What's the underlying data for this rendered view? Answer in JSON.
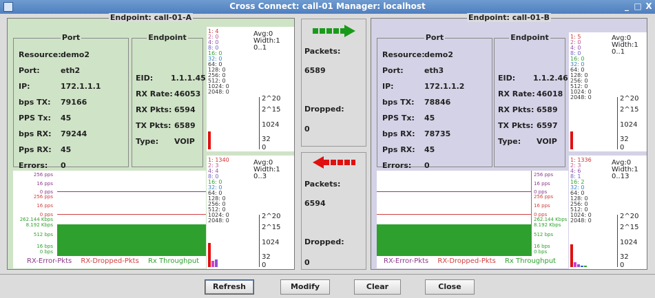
{
  "window": {
    "title": "Cross Connect: call-01  Manager: localhost",
    "controls": [
      "_",
      "□",
      "X"
    ]
  },
  "labels": {
    "port": "Port",
    "endpoint": "Endpoint",
    "resource": "Resource:",
    "port_field": "Port:",
    "ip": "IP:",
    "bps_tx": "bps TX:",
    "pps_tx": "PPS Tx:",
    "bps_rx": "bps RX:",
    "pps_rx": "Pps RX:",
    "errors": "Errors:",
    "eid": "EID:",
    "rx_rate": "RX Rate:",
    "rx_pkts": "RX Pkts:",
    "tx_pkts": "TX Pkts:",
    "type": "Type:",
    "packets": "Packets:",
    "dropped": "Dropped:"
  },
  "endpoint_a": {
    "title": "Endpoint: call-01-A",
    "port": {
      "resource": "demo2",
      "port": "eth2",
      "ip": "172.1.1.1",
      "bps_tx": "79166",
      "pps_tx": "45",
      "bps_rx": "79244",
      "pps_rx": "45",
      "errors": "0"
    },
    "endpoint": {
      "eid": "1.1.1.45",
      "rx_rate": "46053",
      "rx_pkts": "6594",
      "tx_pkts": "6589",
      "type": "VOIP"
    },
    "hist_top": {
      "bins": [
        "1: 4",
        "2: 0",
        "4: 0",
        "8: 0",
        "16: 0",
        "32: 0",
        "64: 0",
        "128: 0",
        "256: 0",
        "512: 0",
        "1024: 0",
        "2048: 0"
      ],
      "avg": "Avg:0",
      "width": "Width:1",
      "range": "0..1",
      "ticks": [
        "2^20",
        "2^15",
        "1024",
        "32",
        "0"
      ],
      "bars": [
        0.6
      ]
    },
    "hist_bottom": {
      "bins": [
        "1: 1340",
        "2: 3",
        "4: 4",
        "8: 0",
        "16: 0",
        "32: 0",
        "64: 0",
        "128: 0",
        "256: 0",
        "512: 0",
        "1024: 0",
        "2048: 0"
      ],
      "avg": "Avg:0",
      "width": "Width:1",
      "range": "0..3",
      "ticks": [
        "2^20",
        "2^15",
        "1024",
        "32",
        "0"
      ],
      "bars": [
        0.8,
        0.2,
        0.25
      ]
    },
    "throughput": {
      "y_labels": [
        "256 pps",
        "16 pps",
        "0 pps",
        "256 pps",
        "16 pps",
        "0 pps",
        "262.144 Kbps",
        "8.192 Kbps",
        "512 bps",
        "16 bps",
        "0 bps"
      ],
      "legend": [
        "RX-Error-Pkts",
        "RX-Dropped-Pkts",
        "Rx Throughput"
      ]
    }
  },
  "endpoint_b": {
    "title": "Endpoint: call-01-B",
    "port": {
      "resource": "demo2",
      "port": "eth3",
      "ip": "172.1.1.2",
      "bps_tx": "78846",
      "pps_tx": "45",
      "bps_rx": "78735",
      "pps_rx": "45",
      "errors": "0"
    },
    "endpoint": {
      "eid": "1.1.2.46",
      "rx_rate": "46018",
      "rx_pkts": "6589",
      "tx_pkts": "6597",
      "type": "VOIP"
    },
    "hist_top": {
      "bins": [
        "1: 5",
        "2: 0",
        "4: 0",
        "8: 0",
        "16: 0",
        "32: 0",
        "64: 0",
        "128: 0",
        "256: 0",
        "512: 0",
        "1024: 0",
        "2048: 0"
      ],
      "avg": "Avg:0",
      "width": "Width:1",
      "range": "0..1",
      "ticks": [
        "2^20",
        "2^15",
        "1024",
        "32",
        "0"
      ],
      "bars": [
        0.6
      ]
    },
    "hist_bottom": {
      "bins": [
        "1: 1336",
        "2: 3",
        "4: 6",
        "8: 1",
        "16: 2",
        "32: 0",
        "64: 0",
        "128: 0",
        "256: 0",
        "512: 0",
        "1024: 0",
        "2048: 0"
      ],
      "avg": "Avg:0",
      "width": "Width:1",
      "range": "0..13",
      "ticks": [
        "2^20",
        "2^15",
        "1024",
        "32",
        "0"
      ],
      "bars": [
        0.75,
        0.15,
        0.1,
        0.05,
        0.05
      ]
    },
    "throughput": {
      "y_labels": [
        "256 pps",
        "16 pps",
        "0 pps",
        "256 pps",
        "16 pps",
        "0 pps",
        "262.144 Kbps",
        "8.192 Kbps",
        "512 bps",
        "16 bps",
        "0 bps"
      ],
      "legend": [
        "RX-Error-Pkts",
        "RX-Dropped-Pkts",
        "Rx Throughput"
      ]
    }
  },
  "center": {
    "a_to_b": {
      "packets": "6589",
      "dropped": "0"
    },
    "b_to_a": {
      "packets": "6594",
      "dropped": "0"
    }
  },
  "buttons": {
    "refresh": "Refresh",
    "modify": "Modify",
    "clear": "Clear",
    "close": "Close"
  },
  "colors": {
    "panel_a": "#cfe3c7",
    "panel_b": "#d4d2e6",
    "arrow_green": "#1a9a1a",
    "arrow_red": "#e01010",
    "throughput": "#2ea02e",
    "error_line": "#8b3a8b",
    "dropped_line": "#d04040"
  }
}
